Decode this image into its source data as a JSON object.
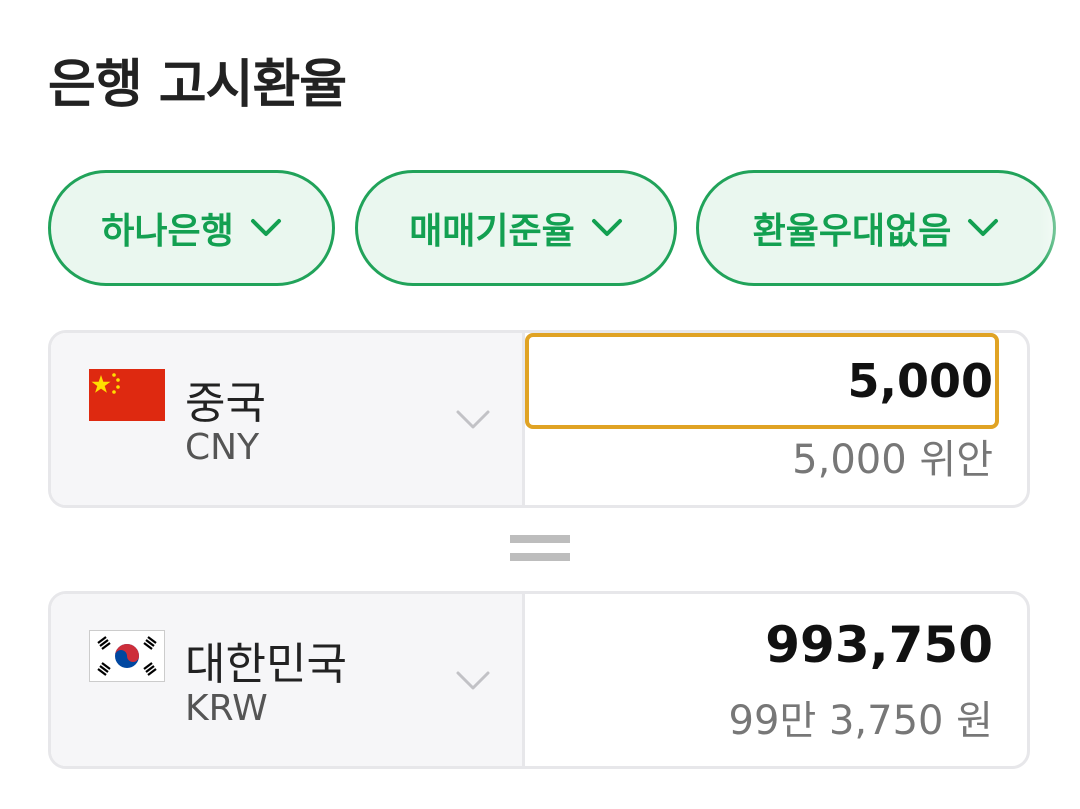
{
  "header": {
    "title": "은행 고시환율"
  },
  "filters": [
    {
      "label": "하나은행"
    },
    {
      "label": "매매기준율"
    },
    {
      "label": "환율우대없음"
    }
  ],
  "from": {
    "country": "중국",
    "code": "CNY",
    "amount": "5,000",
    "amount_text": "5,000 위안"
  },
  "to": {
    "country": "대한민국",
    "code": "KRW",
    "amount": "993,750",
    "amount_text": "99만 3,750 원"
  },
  "colors": {
    "accent": "#13a051",
    "chip_bg": "#eaf7ef",
    "focus": "#e0a324"
  },
  "icons": {
    "chip": "chevron-down-icon",
    "equals": "equals-icon"
  }
}
